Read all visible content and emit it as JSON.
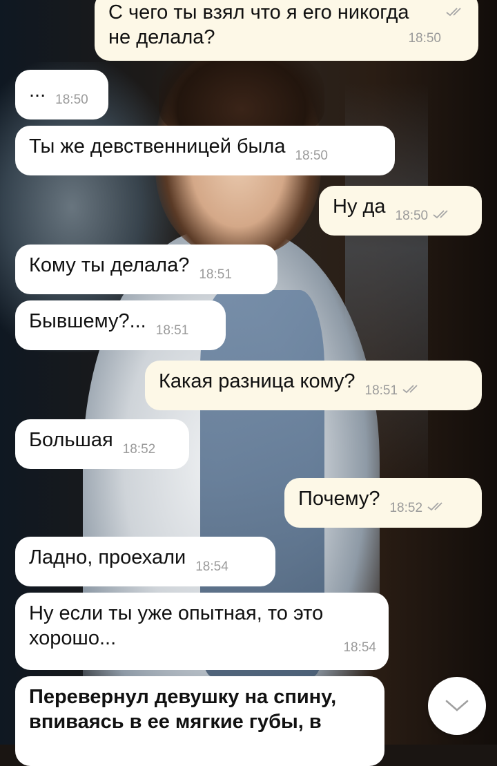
{
  "messages": [
    {
      "dir": "out",
      "text": "С чего ты взял что я его никогда\nне делала?",
      "time": "18:50",
      "read": true
    },
    {
      "dir": "in",
      "text": "...",
      "time": "18:50"
    },
    {
      "dir": "in",
      "text": "Ты же девственницей была",
      "time": "18:50"
    },
    {
      "dir": "out",
      "text": "Ну да",
      "time": "18:50",
      "read": true
    },
    {
      "dir": "in",
      "text": "Кому ты делала?",
      "time": "18:51"
    },
    {
      "dir": "in",
      "text": "Бывшему?...",
      "time": "18:51"
    },
    {
      "dir": "out",
      "text": "Какая разница кому?",
      "time": "18:51",
      "read": true
    },
    {
      "dir": "in",
      "text": "Большая",
      "time": "18:52"
    },
    {
      "dir": "out",
      "text": "Почему?",
      "time": "18:52",
      "read": true
    },
    {
      "dir": "in",
      "text": "Ладно, проехали",
      "time": "18:54"
    },
    {
      "dir": "in",
      "text": "Ну если ты уже опытная, то это\nхорошо...",
      "time": "18:54"
    },
    {
      "dir": "in",
      "text": "Перевернул девушку на спину,\nвпиваясь в ее мягкие губы, в",
      "bold": true
    }
  ],
  "scroll_button": {
    "icon": "chevron-down-icon"
  },
  "colors": {
    "incoming": "#ffffff",
    "outgoing": "#fdf8e7",
    "time": "#9a9a9a",
    "ticks": "#a6a6a6"
  }
}
